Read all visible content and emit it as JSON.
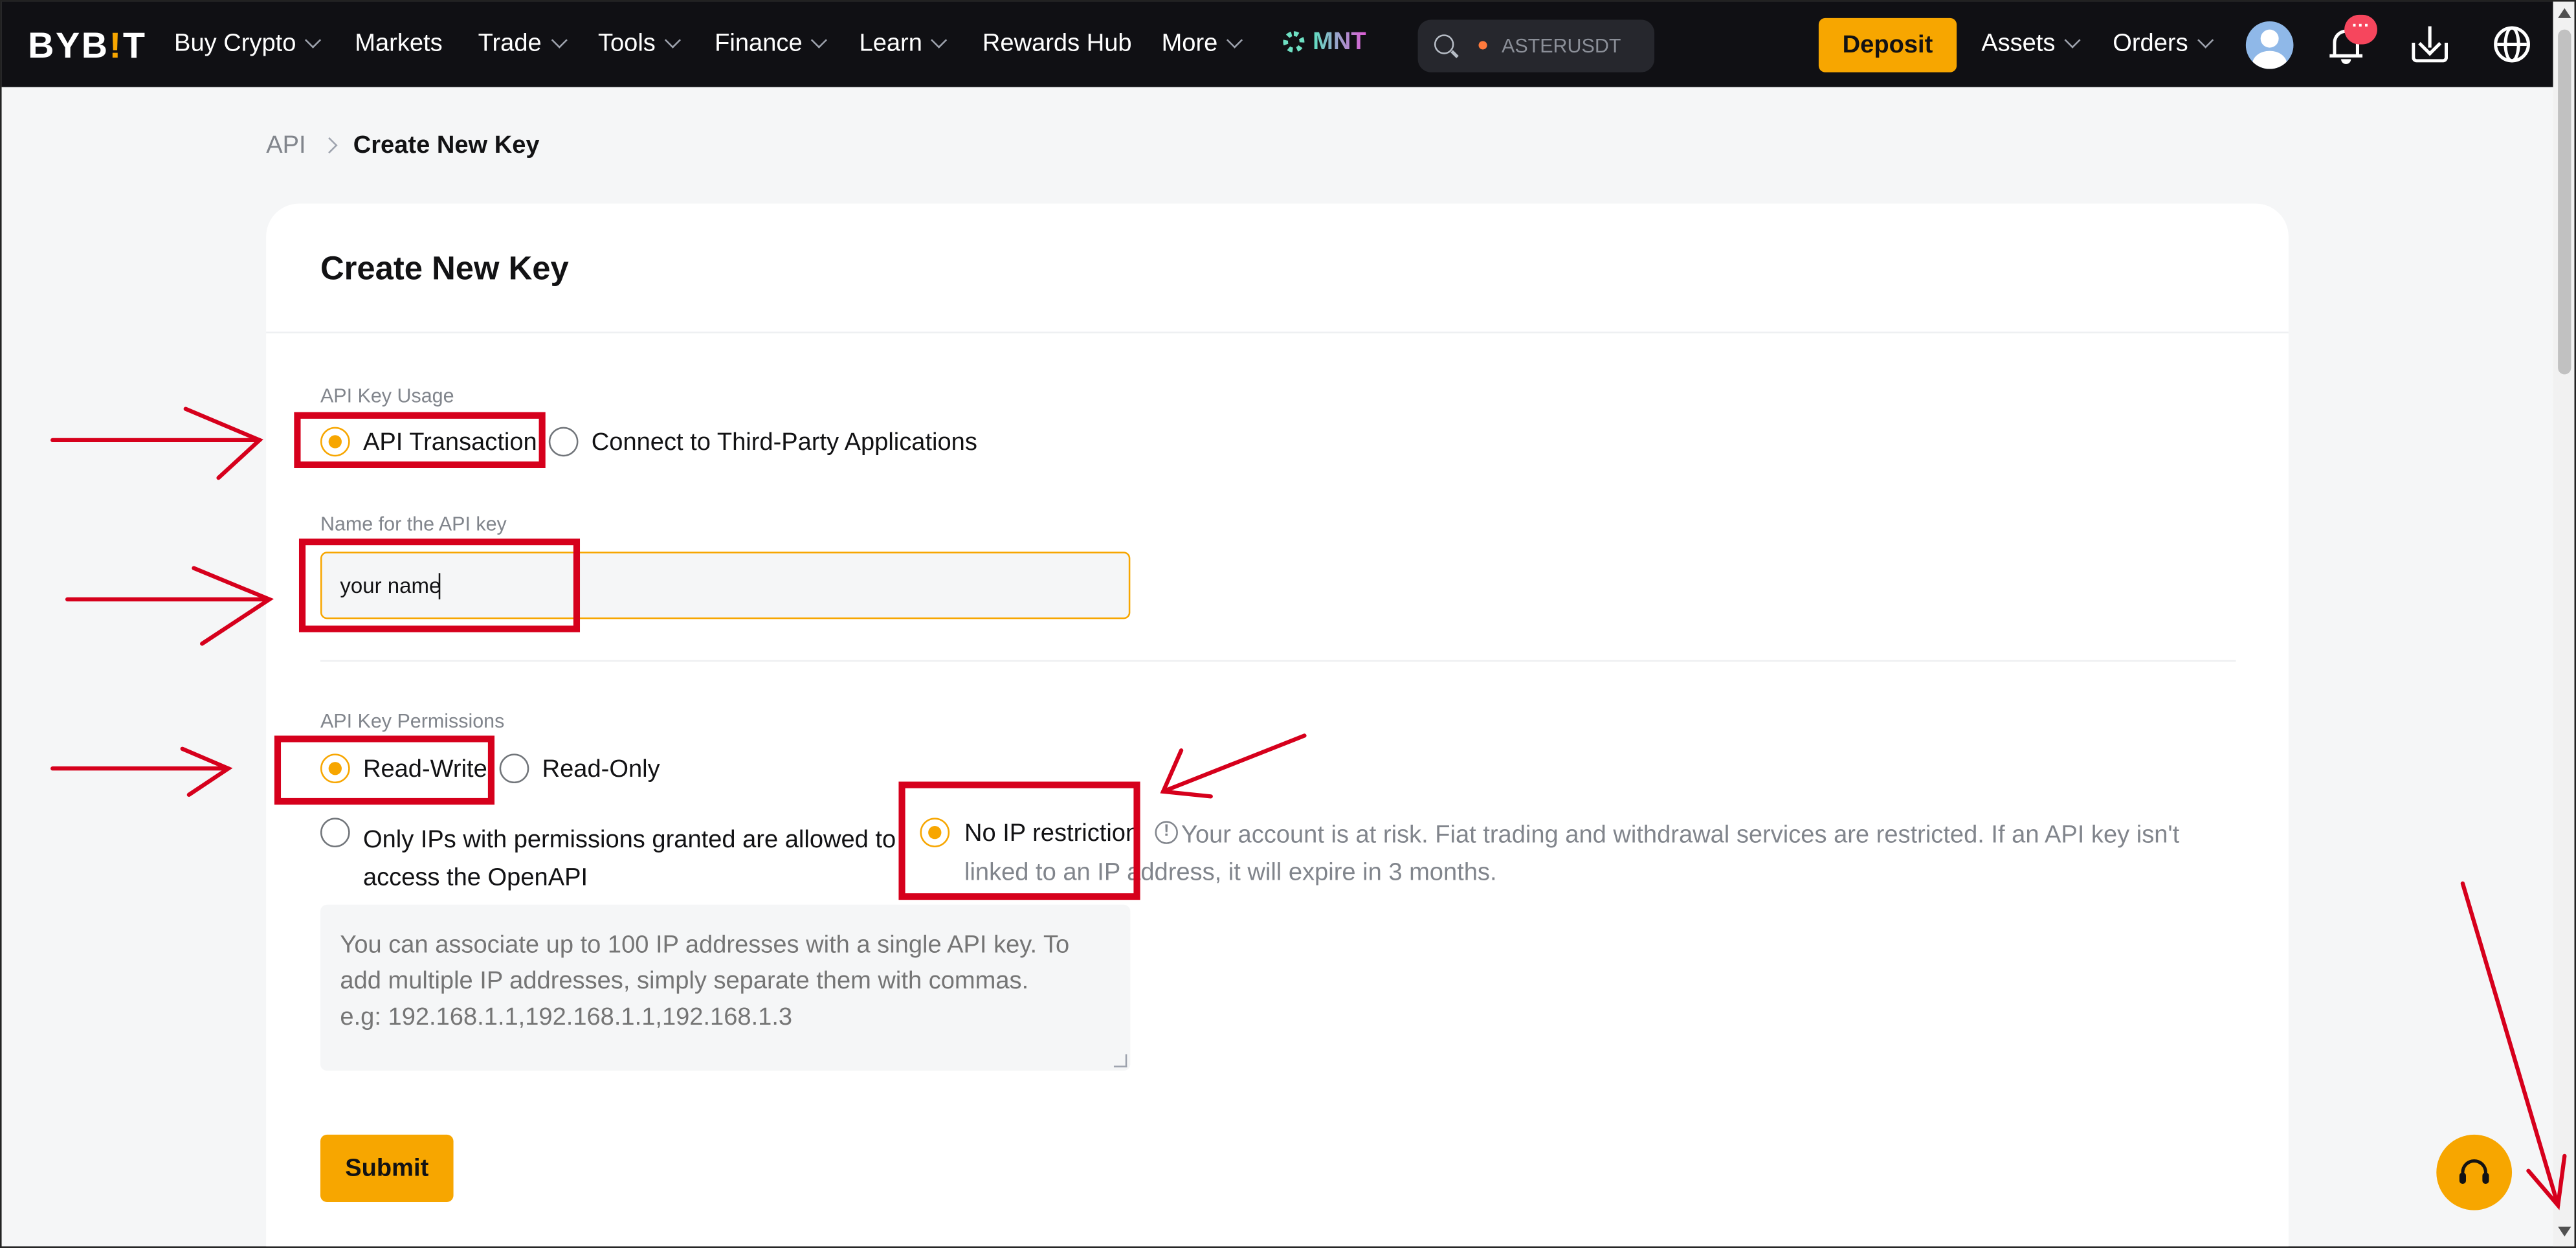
{
  "nav": {
    "logo_main": "BYB",
    "logo_mark": "!",
    "logo_end": "T",
    "items": [
      {
        "label": "Buy Crypto",
        "caret": true
      },
      {
        "label": "Markets",
        "caret": false
      },
      {
        "label": "Trade",
        "caret": true
      },
      {
        "label": "Tools",
        "caret": true
      },
      {
        "label": "Finance",
        "caret": true
      },
      {
        "label": "Learn",
        "caret": true
      },
      {
        "label": "Rewards Hub",
        "caret": false
      },
      {
        "label": "More",
        "caret": true
      }
    ],
    "token": "MNT",
    "search_value": "ASTERUSDT",
    "deposit": "Deposit",
    "assets": "Assets",
    "orders": "Orders",
    "notification_badge": "···"
  },
  "breadcrumb": {
    "root": "API",
    "current": "Create New Key"
  },
  "form": {
    "title": "Create New Key",
    "usage_label": "API Key Usage",
    "usage_options": [
      "API Transaction",
      "Connect to Third-Party Applications"
    ],
    "usage_selected": "API Transaction",
    "name_label": "Name for the API key",
    "name_value": "your name",
    "permissions_label": "API Key Permissions",
    "permission_options": [
      "Read-Write",
      "Read-Only"
    ],
    "permission_selected": "Read-Write",
    "ip_option_restricted": "Only IPs with permissions granted are allowed to access the OpenAPI",
    "ip_option_none": "No IP restriction",
    "ip_selected": "No IP restriction",
    "ip_warning": "Your account is at risk. Fiat trading and withdrawal services are restricted. If an API key isn't linked to an IP address, it will expire in 3 months.",
    "ip_placeholder": "You can associate up to 100 IP addresses with a single API key. To add multiple IP addresses, simply separate them with commas.\ne.g: 192.168.1.1,192.168.1.1,192.168.1.3",
    "submit": "Submit"
  },
  "colors": {
    "brand": "#f7a600",
    "nav_bg": "#101014",
    "annotation": "#d6001c"
  },
  "icons": [
    "search-icon",
    "fire-icon",
    "user-avatar-icon",
    "bell-icon",
    "download-icon",
    "globe-icon",
    "warning-icon",
    "headset-icon"
  ]
}
